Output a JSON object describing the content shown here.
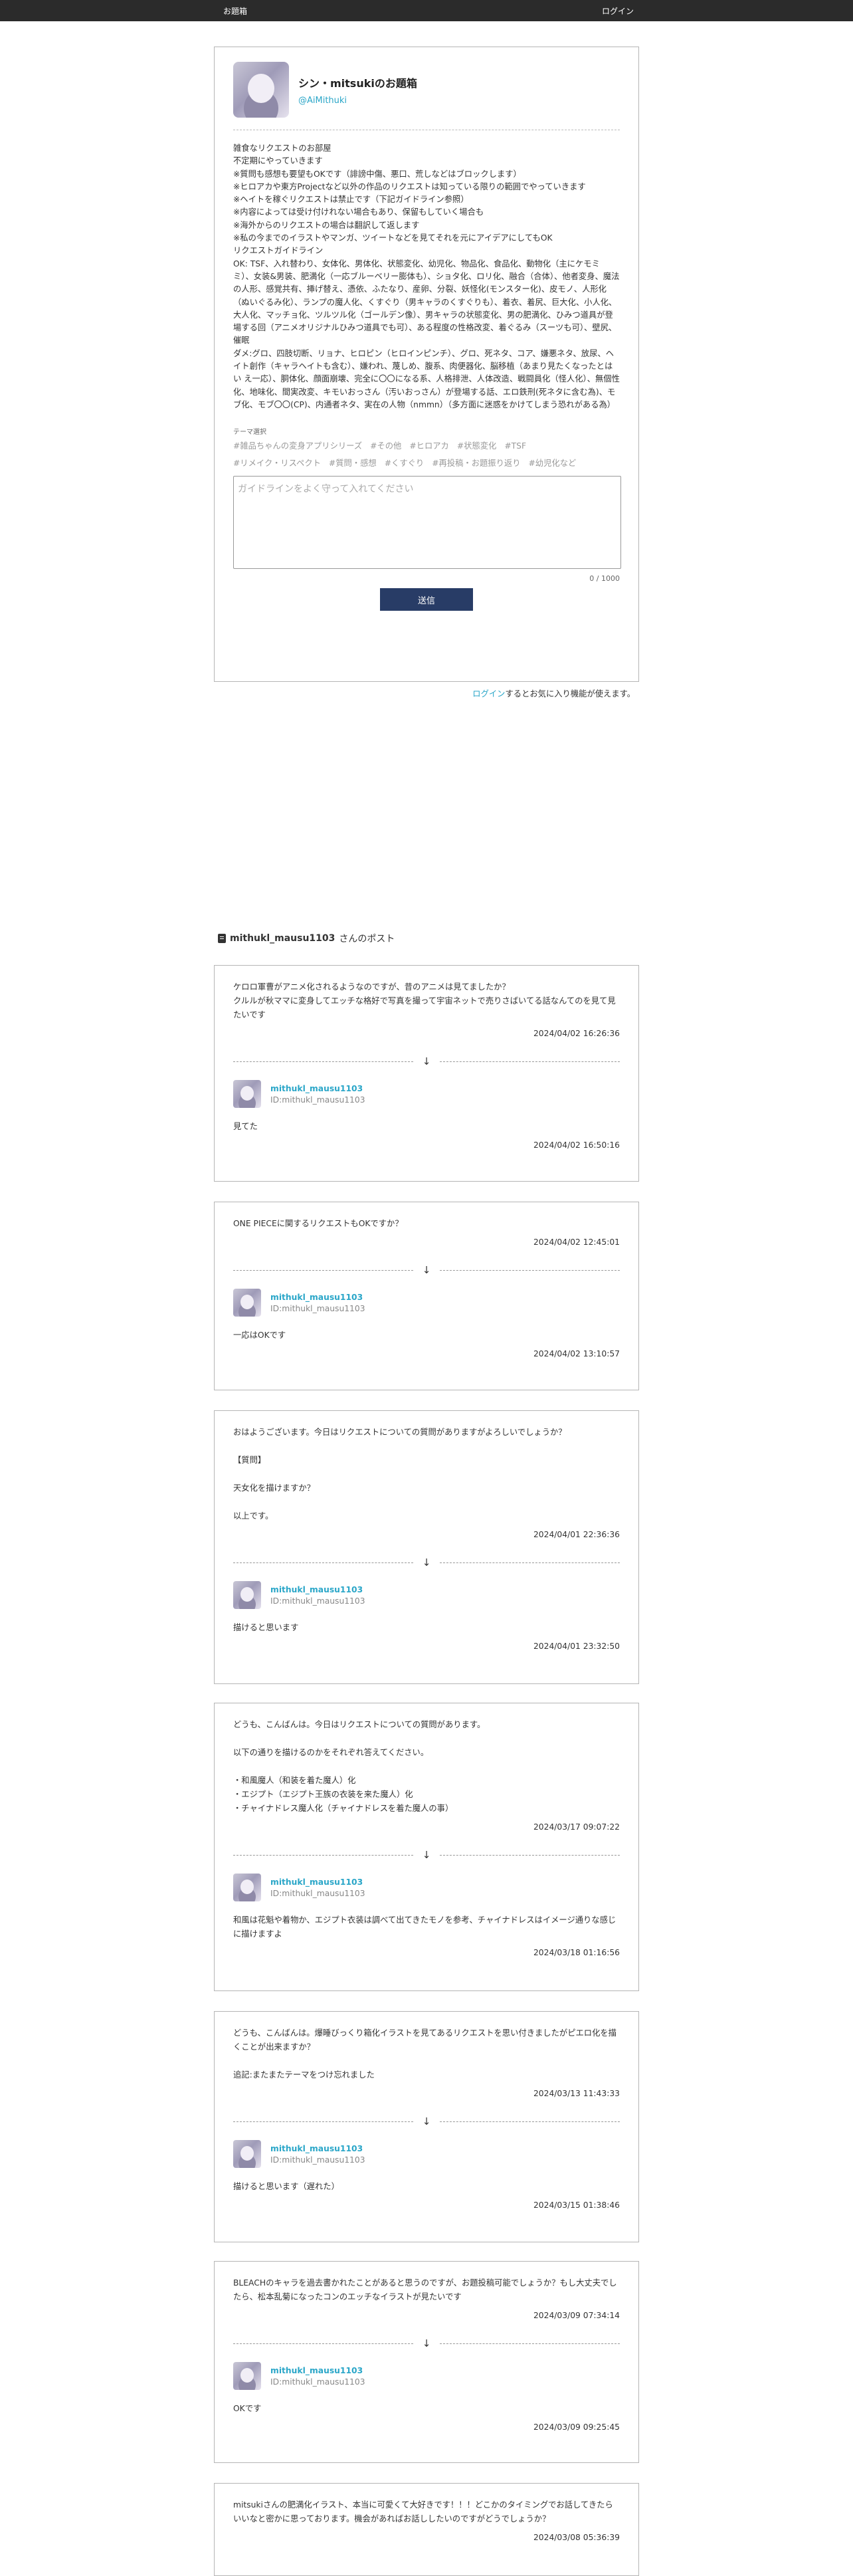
{
  "topbar": {
    "brand": "お題箱",
    "login": "ログイン"
  },
  "profile": {
    "name": "シン・mitsukiのお題箱",
    "id": "@AiMithuki",
    "guideline": "雑食なリクエストのお部屋\n不定期にやっていきます\n※質問も感想も要望もOKです（誹謗中傷、悪口、荒しなどはブロックします）\n※ヒロアカや東方Projectなど以外の作品のリクエストは知っている限りの範囲でやっていきます\n※ヘイトを稼ぐリクエストは禁止です（下記ガイドライン参照）\n※内容によっては受け付けれない場合もあり、保留もしていく場合も\n※海外からのリクエストの場合は翻訳して返します\n※私の今までのイラストやマンガ、ツイートなどを見てそれを元にアイデアにしてもOK\nリクエストガイドライン\nOK: TSF、入れ替わり、女体化、男体化、状態変化、幼児化、物品化、食品化、動物化（主にケモミミ）、女装&男装、肥満化（一応ブルーベリー膨体も）、ショタ化、ロリ化、融合（合体）、他者変身、魔法の人形、感覚共有、挿げ替え、憑依、ふたなり、産卵、分裂、妖怪化(モンスター化)、皮モノ、人形化（ぬいぐるみ化）、ランプの魔人化、くすぐり（男キャラのくすぐりも）、着衣、着尻、巨大化、小人化、大人化、マッチョ化、ツルツル化（ゴールデン像）、男キャラの状態変化、男の肥満化、ひみつ道具が登場する回（アニメオリジナルひみつ道具でも可）、ある程度の性格改変、着ぐるみ（スーツも可）、壁尻、催眠\nダメ:グロ、四肢切断、リョナ、ヒロピン（ヒロインピンチ）、グロ、死ネタ、コア、嫌悪ネタ、放尿、ヘイト創作（キャラヘイトも含む）、嫌われ、蔑しめ、腹系、肉便器化、脳移植（あまり見たくなったとはい え一応）、胴体化、顔面崩壊、完全に〇〇になる系、人格排泄、人体改造、戦闘員化（怪人化）、無個性化、地味化、間実改変、キモいおっさん（汚いおっさん）が登場する話、エロ鉄刑(死ネタに含む為)、モブ化、モブ〇〇(CP)、内通者ネタ、実在の人物（nmmn）（多方面に迷惑をかけてしまう恐れがある為）",
    "theme_label": "テーマ選択",
    "tags": [
      "#雑品ちゃんの変身アプリシリーズ",
      "#その他",
      "#ヒロアカ",
      "#状態変化",
      "#TSF",
      "#リメイク・リスペクト",
      "#質問・感想",
      "#くすぐり",
      "#再投稿・お題振り返り",
      "#幼児化など"
    ],
    "textarea_placeholder": "ガイドラインをよく守って入れてください",
    "counter": "0 / 1000",
    "send_label": "送信"
  },
  "login_note": {
    "link": "ログイン",
    "text": "するとお気に入り機能が使えます。"
  },
  "posts_header": {
    "user": "mithukl_mausu1103",
    "suffix": "さんのポスト"
  },
  "posts": [
    {
      "text": "ケロロ軍曹がアニメ化されるようなのですが、昔のアニメは見てましたか？\nクルルが秋ママに変身してエッチな格好で写真を撮って宇宙ネットで売りさばいてる話なんてのを見て見たいです",
      "date": "2024/04/02 16:26:36",
      "reply_name": "mithukl_mausu1103",
      "reply_id": "ID:mithukl_mausu1103",
      "reply_text": "見てた",
      "reply_date": "2024/04/02 16:50:16"
    },
    {
      "text": "ONE PIECEに関するリクエストもOKですか？",
      "date": "2024/04/02 12:45:01",
      "reply_name": "mithukl_mausu1103",
      "reply_id": "ID:mithukl_mausu1103",
      "reply_text": "一応はOKです",
      "reply_date": "2024/04/02 13:10:57"
    },
    {
      "text": "おはようございます。今日はリクエストについての質問がありますがよろしいでしょうか？\n\n【質問】\n\n天女化を描けますか？\n\n以上です。",
      "date": "2024/04/01 22:36:36",
      "reply_name": "mithukl_mausu1103",
      "reply_id": "ID:mithukl_mausu1103",
      "reply_text": "描けると思います",
      "reply_date": "2024/04/01 23:32:50"
    },
    {
      "text": "どうも、こんばんは。今日はリクエストについての質問があります。\n\n以下の通りを描けるのかをそれぞれ答えてください。\n\n・和風魔人（和装を着た魔人）化\n・エジプト（エジプト王族の衣装を来た魔人）化\n・チャイナドレス魔人化（チャイナドレスを着た魔人の事）",
      "date": "2024/03/17 09:07:22",
      "reply_name": "mithukl_mausu1103",
      "reply_id": "ID:mithukl_mausu1103",
      "reply_text": "和風は花魁や着物か、エジプト衣装は調べて出てきたモノを参考、チャイナドレスはイメージ通りな感じに描けますよ",
      "reply_date": "2024/03/18 01:16:56"
    },
    {
      "text": "どうも、こんばんは。爆睡びっくり箱化イラストを見てあるリクエストを思い付きましたがピエロ化を描くことが出来ますか？\n\n追記:またまたテーマをつけ忘れました",
      "date": "2024/03/13 11:43:33",
      "reply_name": "mithukl_mausu1103",
      "reply_id": "ID:mithukl_mausu1103",
      "reply_text": "描けると思います（遅れた）",
      "reply_date": "2024/03/15 01:38:46"
    },
    {
      "text": "BLEACHのキャラを過去書かれたことがあると思うのですが、お題投稿可能でしょうか？もし大丈夫でしたら、松本乱菊になったコンのエッチなイラストが見たいです",
      "date": "2024/03/09 07:34:14",
      "reply_name": "mithukl_mausu1103",
      "reply_id": "ID:mithukl_mausu1103",
      "reply_text": "OKです",
      "reply_date": "2024/03/09 09:25:45"
    },
    {
      "text": "mitsukiさんの肥満化イラスト、本当に可愛くて大好きです！！！どこかのタイミングでお話してきたらいいなと密かに思っております。機会があればお話ししたいのですがどうでしょうか？",
      "date": "2024/03/08 05:36:39"
    }
  ]
}
